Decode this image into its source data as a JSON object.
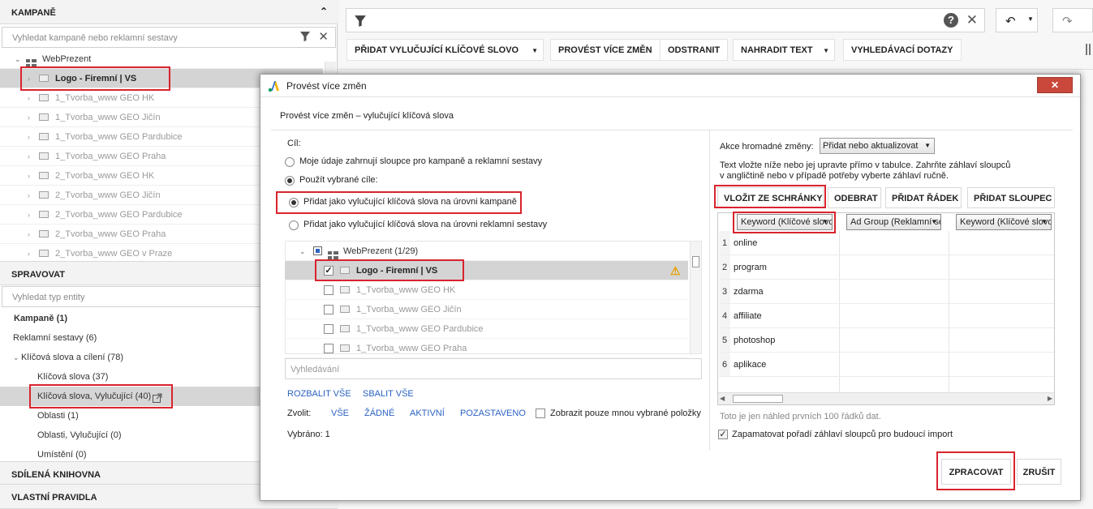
{
  "left": {
    "campaigns_header": "KAMPANĚ",
    "campaign_search_placeholder": "Vyhledat kampaně nebo reklamní sestavy",
    "account": "WebPrezent",
    "campaigns": [
      "Logo - Firemní | VS",
      "1_Tvorba_www GEO HK",
      "1_Tvorba_www GEO Jičín",
      "1_Tvorba_www GEO Pardubice",
      "1_Tvorba_www GEO Praha",
      "2_Tvorba_www GEO HK",
      "2_Tvorba_www GEO Jičín",
      "2_Tvorba_www GEO Pardubice",
      "2_Tvorba_www GEO Praha",
      "2_Tvorba_www GEO v Praze"
    ],
    "manage_header": "SPRAVOVAT",
    "entity_search_placeholder": "Vyhledat typ entity",
    "manage_items": [
      "Kampaně (1)",
      "Reklamní sestavy (6)",
      "Klíčová slova a cílení (78)",
      "Klíčová slova (37)",
      "Klíčová slova, Vylučující (40)",
      "Oblasti (1)",
      "Oblasti, Vylučující (0)",
      "Umístění (0)"
    ],
    "shared_library": "SDÍLENÁ KNIHOVNA",
    "custom_rules": "VLASTNÍ PRAVIDLA"
  },
  "toolbar": {
    "add_negative": "PŘIDAT VYLUČUJÍCÍ KLÍČOVÉ SLOVO",
    "make_changes": "PROVÉST VÍCE ZMĚN",
    "remove": "ODSTRANIT",
    "replace_text": "NAHRADIT TEXT",
    "search_terms": "VYHLEDÁVACÍ DOTAZY"
  },
  "dialog": {
    "title": "Provést více změn",
    "subtitle": "Provést více změn – vylučující klíčová slova",
    "target_label": "Cíl:",
    "radio1": "Moje údaje zahrnují sloupce pro kampaně a reklamní sestavy",
    "radio2": "Použít vybrané cíle:",
    "radio3": "Přidat jako vylučující klíčová slova na úrovni kampaně",
    "radio4": "Přidat jako vylučující klíčová slova na úrovni reklamní sestavy",
    "tree_root": "WebPrezent (1/29)",
    "tree_items": [
      "Logo - Firemní | VS",
      "1_Tvorba_www GEO HK",
      "1_Tvorba_www GEO Jičín",
      "1_Tvorba_www GEO Pardubice",
      "1_Tvorba_www GEO Praha"
    ],
    "search_placeholder": "Vyhledávání",
    "expand_all": "ROZBALIT VŠE",
    "collapse_all": "SBALIT VŠE",
    "choose_label": "Zvolit:",
    "choose_all": "VŠE",
    "choose_none": "ŽÁDNÉ",
    "choose_active": "AKTIVNÍ",
    "choose_paused": "POZASTAVENO",
    "show_selected": "Zobrazit pouze mnou vybrané položky",
    "selected_count": "Vybráno: 1",
    "bulk_action_label": "Akce hromadné změny:",
    "bulk_action_value": "Přidat nebo aktualizovat",
    "instructions_line1": "Text vložte níže nebo jej upravte přímo v tabulce. Zahrňte záhlaví sloupců",
    "instructions_line2": "v angličtině nebo v případě potřeby vyberte záhlaví ručně.",
    "paste_btn": "VLOŽIT ZE SCHRÁNKY",
    "remove_btn": "ODEBRAT",
    "add_row_btn": "PŘIDAT ŘÁDEK",
    "add_col_btn": "PŘIDAT SLOUPEC",
    "col1": "Keyword (Klíčové slovo)",
    "col2": "Ad Group (Reklamní sestava)",
    "col3": "Keyword (Klíčové slovo)",
    "rows": [
      "online",
      "program",
      "zdarma",
      "affiliate",
      "photoshop",
      "aplikace"
    ],
    "preview_note": "Toto je jen náhled prvních 100 řádků dat.",
    "remember_cols": "Zapamatovat pořadí záhlaví sloupců pro budoucí import",
    "process_btn": "ZPRACOVAT",
    "cancel_btn": "ZRUŠIT"
  }
}
